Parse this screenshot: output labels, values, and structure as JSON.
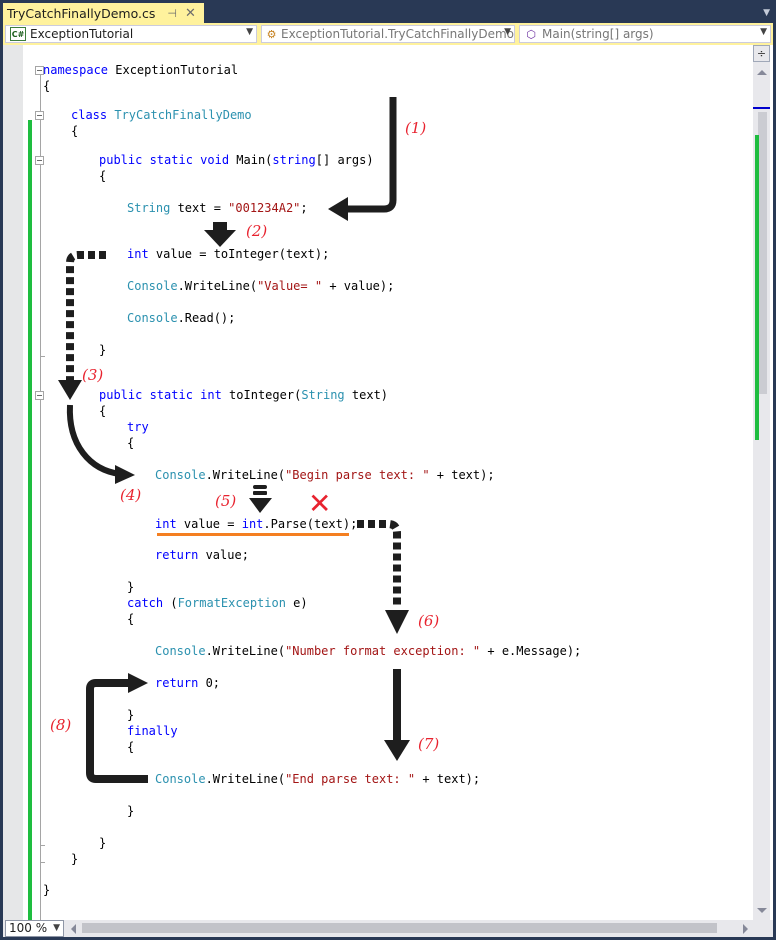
{
  "tab": {
    "title": "TryCatchFinallyDemo.cs",
    "pin_icon": "pin-icon",
    "close_icon": "close-icon"
  },
  "navbar": {
    "project": {
      "label": "ExceptionTutorial",
      "icon": "csharp-project-icon"
    },
    "class": {
      "label": "ExceptionTutorial.TryCatchFinallyDemo",
      "icon": "class-icon"
    },
    "member": {
      "label": "Main(string[] args)",
      "icon": "method-icon"
    }
  },
  "code": {
    "l1": {
      "kw": "namespace",
      "rest": " ExceptionTutorial"
    },
    "l2": "{",
    "l3": {
      "kw": "class",
      "ty": "TryCatchFinallyDemo"
    },
    "l4": "{",
    "l5": {
      "kw": "public static void",
      "rest": " Main(",
      "kw2": "string",
      "rest2": "[] args)"
    },
    "l6": "{",
    "l7": {
      "ty": "String",
      "rest": " text = ",
      "st": "\"001234A2\"",
      "end": ";"
    },
    "l8": {
      "kw": "int",
      "rest": " value = toInteger(text);"
    },
    "l9": {
      "ty": "Console",
      "rest": ".WriteLine(",
      "st": "\"Value= \"",
      "end": " + value);"
    },
    "l10": {
      "ty": "Console",
      "rest": ".Read();"
    },
    "l11": "}",
    "l12": {
      "kw": "public static int",
      "rest": " toInteger(",
      "ty": "String",
      "end": " text)"
    },
    "l13": "{",
    "l14": {
      "kw": "try"
    },
    "l15": "{",
    "l16": {
      "ty": "Console",
      "rest": ".WriteLine(",
      "st": "\"Begin parse text: \"",
      "end": " + text);"
    },
    "l17": {
      "kw": "int",
      "rest": " value = ",
      "kw2": "int",
      "end": ".Parse(text);"
    },
    "l18": {
      "kw": "return",
      "rest": " value;"
    },
    "l19": "}",
    "l20": {
      "kw": "catch",
      "rest": " (",
      "ty": "FormatException",
      "end": " e)"
    },
    "l21": "{",
    "l22": {
      "ty": "Console",
      "rest": ".WriteLine(",
      "st": "\"Number format exception: \"",
      "end": " + e.Message);"
    },
    "l23": {
      "kw": "return",
      "rest": " 0;"
    },
    "l24": "}",
    "l25": {
      "kw": "finally"
    },
    "l26": "{",
    "l27": {
      "ty": "Console",
      "rest": ".WriteLine(",
      "st": "\"End parse text: \"",
      "end": " + text);"
    },
    "l28": "}",
    "l29": "}",
    "l30": "}",
    "l31": "}"
  },
  "annotations": [
    "(1)",
    "(2)",
    "(3)",
    "(4)",
    "(5)",
    "(6)",
    "(7)",
    "(8)"
  ],
  "error_mark": "✕",
  "zoom": {
    "value": "100 %"
  },
  "colors": {
    "keyword": "#0000ff",
    "type": "#2b91af",
    "string": "#a31515",
    "annotation": "#e8232f",
    "changed_lines": "#1ebd3f",
    "error_underline": "#f47f21",
    "tab_active": "#fff29d",
    "chrome": "#293955"
  }
}
